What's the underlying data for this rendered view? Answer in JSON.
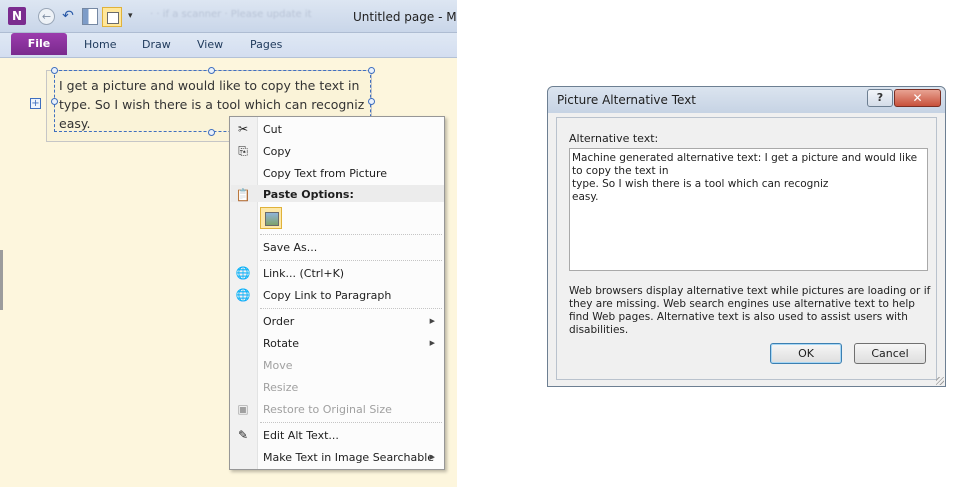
{
  "onenote": {
    "app_icon_letter": "N",
    "quick_access": {
      "back": "←",
      "undo": "↶",
      "customize": "▾"
    },
    "hint_text": "· · if a scanner · Please update it",
    "window_title": "Untitled page  -  Mic",
    "ribbon_tabs": {
      "file": "File",
      "home": "Home",
      "draw": "Draw",
      "view": "View",
      "pages": "Pages"
    },
    "picture_text": "I get a picture and would like to copy the text in\ntype. So I wish there is a tool which can recogniz\neasy.",
    "move_handle_icon": "+"
  },
  "context_menu": {
    "items": {
      "cut": "Cut",
      "copy": "Copy",
      "copy_text": "Copy Text from Picture",
      "paste_header": "Paste Options:",
      "save_as": "Save As...",
      "link": "Link...  (Ctrl+K)",
      "copy_link": "Copy Link to Paragraph",
      "order": "Order",
      "rotate": "Rotate",
      "move": "Move",
      "resize": "Resize",
      "restore": "Restore to Original Size",
      "edit_alt": "Edit Alt Text...",
      "make_searchable": "Make Text in Image Searchable"
    },
    "icons": {
      "cut": "✂",
      "copy": "⎘",
      "paste": "📋",
      "link": "🌐",
      "copy_link": "🌐",
      "restore": "▣",
      "edit_alt": "✎"
    }
  },
  "dialog": {
    "title": "Picture Alternative Text",
    "help_label": "?",
    "close_label": "✕",
    "alt_label": "Alternative text:",
    "alt_text": "Machine generated alternative text: I get a picture and would like to copy the text in\ntype. So I wish there is a tool which can recogniz\neasy.",
    "help_text": "Web browsers display alternative text while pictures are loading or if they are missing. Web search engines use alternative text to help find Web pages. Alternative text is also used to assist users with disabilities.",
    "ok_label": "OK",
    "cancel_label": "Cancel"
  }
}
